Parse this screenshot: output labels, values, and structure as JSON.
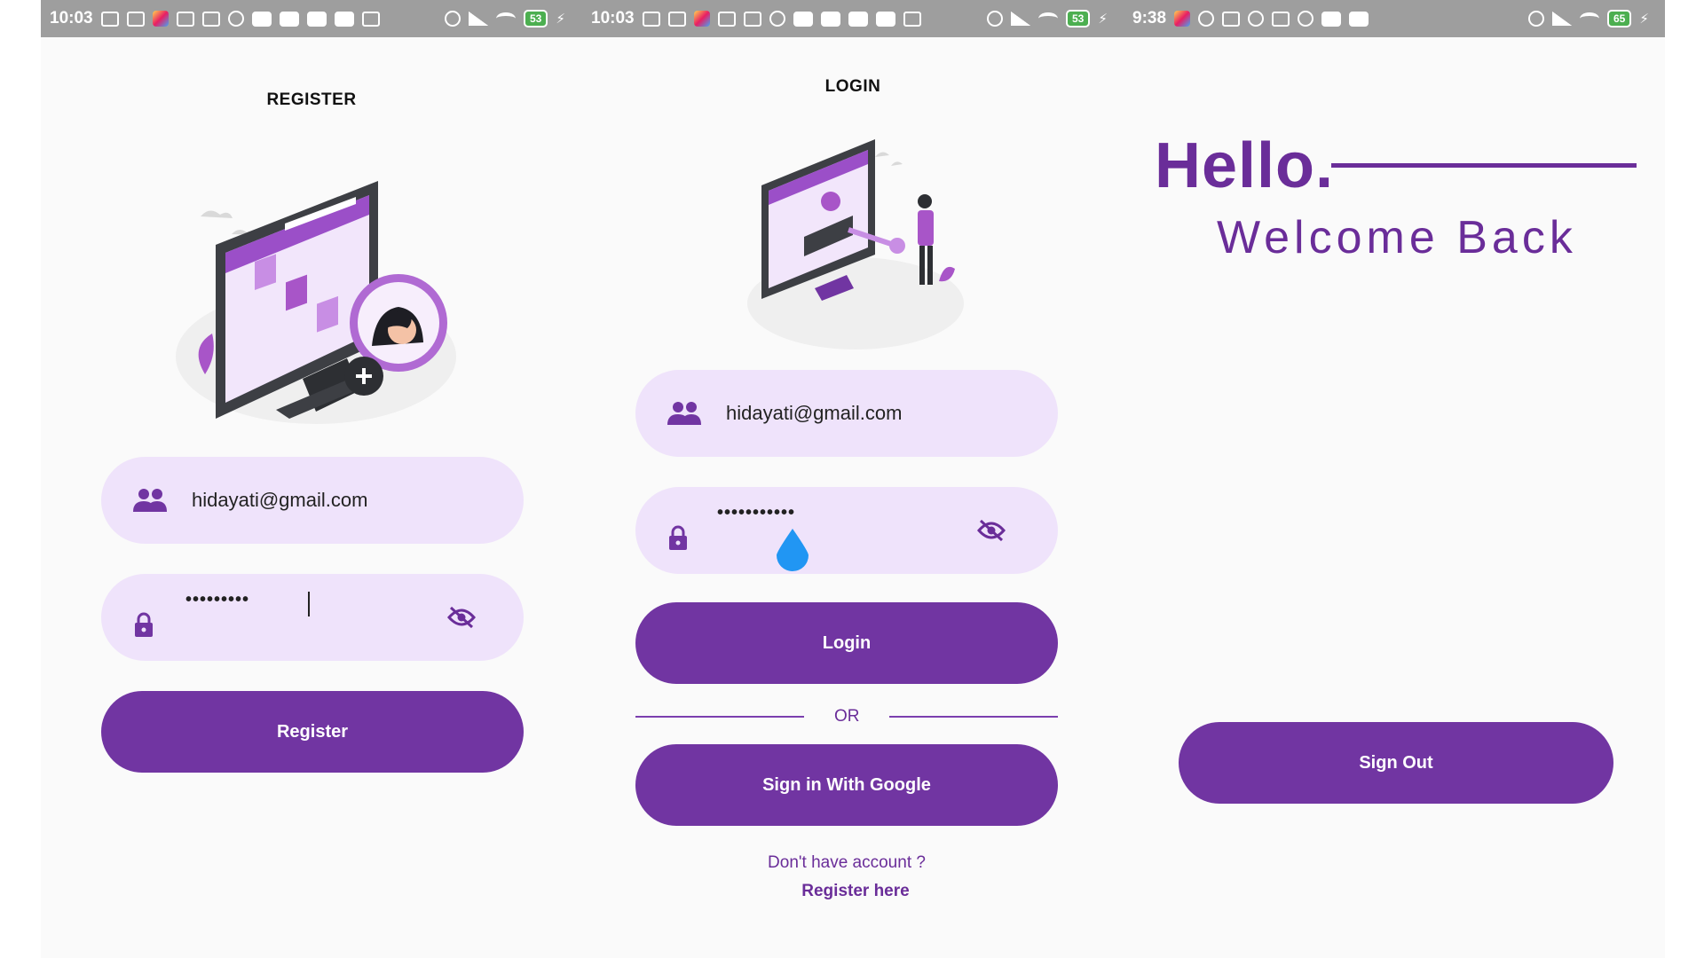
{
  "statusbar": {
    "segments": [
      {
        "time": "10:03",
        "battery": "53"
      },
      {
        "time": "10:03",
        "battery": "53"
      },
      {
        "time": "9:38",
        "battery": "65"
      }
    ]
  },
  "register": {
    "title": "REGISTER",
    "email_value": "hidayati@gmail.com",
    "password_mask": "•••••••••",
    "submit_label": "Register"
  },
  "login": {
    "title": "LOGIN",
    "email_value": "hidayati@gmail.com",
    "password_mask": "•••••••••••",
    "login_label": "Login",
    "separator_label": "OR",
    "google_label": "Sign in With Google",
    "no_account_prompt": "Don't have account ?",
    "register_link": "Register here"
  },
  "home": {
    "greeting": "Hello.",
    "subtitle": "Welcome Back",
    "signout_label": "Sign Out"
  },
  "colors": {
    "primary": "#7135a2",
    "field_bg": "#efe3fb",
    "text_accent": "#6a2d99",
    "statusbar_bg": "#9e9e9e",
    "touch_indicator": "#2196f3"
  },
  "icons": [
    "people-icon",
    "lock-icon",
    "eye-off-icon",
    "notification-icon",
    "alarm-icon",
    "signal-icon",
    "wifi-icon",
    "battery-icon",
    "charging-icon"
  ]
}
